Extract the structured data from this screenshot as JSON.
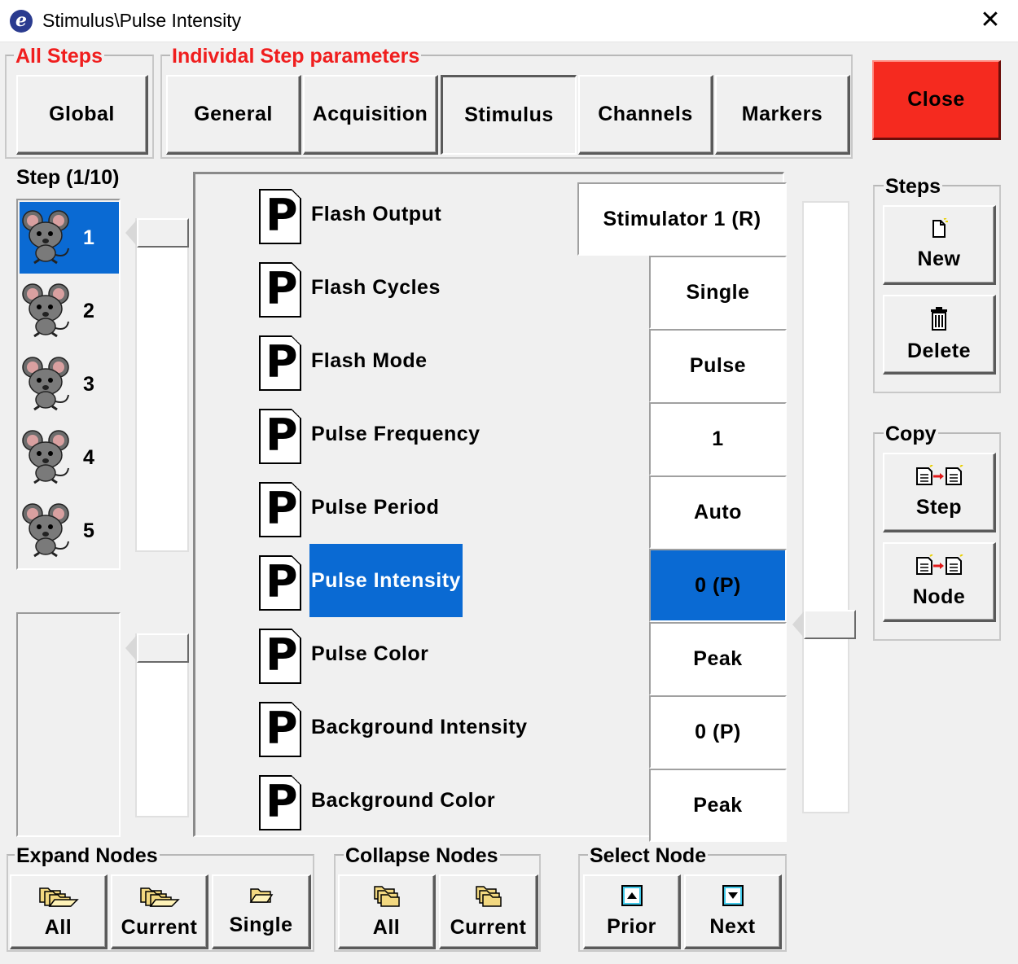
{
  "window": {
    "title": "Stimulus\\Pulse Intensity",
    "close_glyph": "✕",
    "app_icon": "e"
  },
  "all_steps": {
    "label": "All Steps",
    "global_button": "Global"
  },
  "individual": {
    "label": "Individal Step parameters",
    "tabs": [
      "General",
      "Acquisition",
      "Stimulus",
      "Channels",
      "Markers"
    ],
    "active_tab": "Stimulus"
  },
  "close_button": "Close",
  "colors": {
    "accent_red": "#f01e1e",
    "close_red": "#f52a1f",
    "selection_blue": "#0a6ad3"
  },
  "steps_panel": {
    "label": "Step (1/10)",
    "items": [
      {
        "num": "1",
        "selected": true
      },
      {
        "num": "2",
        "selected": false
      },
      {
        "num": "3",
        "selected": false
      },
      {
        "num": "4",
        "selected": false
      },
      {
        "num": "5",
        "selected": false
      }
    ]
  },
  "parameters": [
    {
      "label": "Flash Output",
      "value": "Stimulator 1 (R)",
      "selected": false
    },
    {
      "label": "Flash Cycles",
      "value": "Single",
      "selected": false
    },
    {
      "label": "Flash Mode",
      "value": "Pulse",
      "selected": false
    },
    {
      "label": "Pulse Frequency",
      "value": "1",
      "selected": false
    },
    {
      "label": "Pulse Period",
      "value": "Auto",
      "selected": false
    },
    {
      "label": "Pulse Intensity",
      "value": "0 (P)",
      "selected": true
    },
    {
      "label": "Pulse Color",
      "value": "Peak",
      "selected": false
    },
    {
      "label": "Background Intensity",
      "value": "0 (P)",
      "selected": false
    },
    {
      "label": "Background Color",
      "value": "Peak",
      "selected": false
    }
  ],
  "param_icon_letter": "P",
  "steps_group": {
    "label": "Steps",
    "new": "New",
    "delete": "Delete"
  },
  "copy_group": {
    "label": "Copy",
    "step": "Step",
    "node": "Node"
  },
  "expand_nodes": {
    "label": "Expand Nodes",
    "all": "All",
    "current": "Current",
    "single": "Single"
  },
  "collapse_nodes": {
    "label": "Collapse Nodes",
    "all": "All",
    "current": "Current"
  },
  "select_node": {
    "label": "Select Node",
    "prior": "Prior",
    "next": "Next"
  },
  "icons": {
    "new": "new-document-icon",
    "delete": "trash-icon",
    "copy_step": "copy-step-icon",
    "copy_node": "copy-node-icon",
    "expand_all": "folders-open-icon",
    "expand_current": "folders-open-icon",
    "expand_single": "folder-open-icon",
    "collapse_all": "folders-closed-icon",
    "collapse_current": "folders-closed-icon",
    "prior": "arrow-up-icon",
    "next": "arrow-down-icon",
    "step": "mouse-icon",
    "parameter": "parameter-p-icon"
  }
}
